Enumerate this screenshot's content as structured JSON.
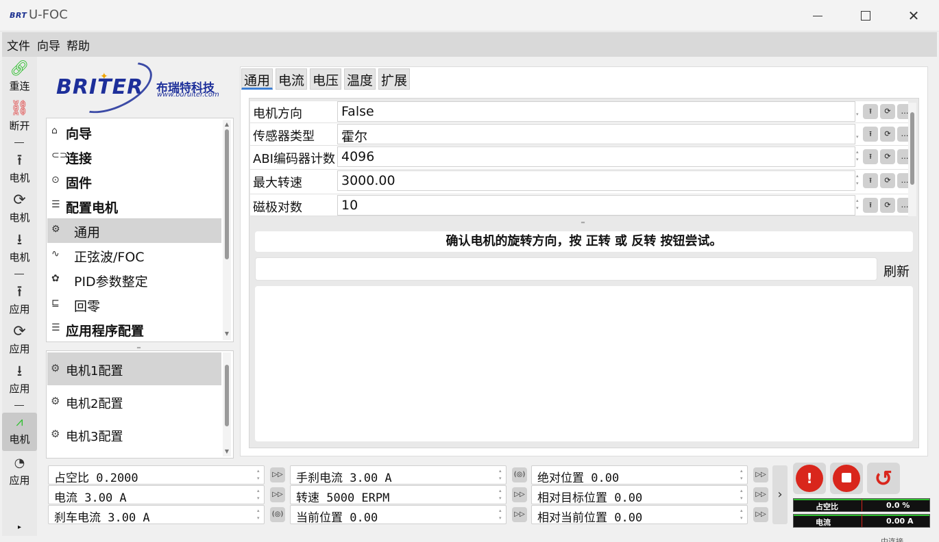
{
  "window": {
    "logo_text": "BRT",
    "title": "U-FOC"
  },
  "menu": {
    "items": [
      "文件",
      "向导",
      "帮助"
    ]
  },
  "toolbar": {
    "items": [
      {
        "icon": "link-icon",
        "label": "重连"
      },
      {
        "icon": "broken-link-icon",
        "label": "断开"
      },
      {
        "icon": "upload-icon",
        "label": "电机"
      },
      {
        "icon": "refresh-icon",
        "label": "电机"
      },
      {
        "icon": "download-icon",
        "label": "电机"
      },
      {
        "icon": "upload-icon",
        "label": "应用"
      },
      {
        "icon": "refresh-icon",
        "label": "应用"
      },
      {
        "icon": "download-icon",
        "label": "应用"
      },
      {
        "icon": "motor-chart-icon",
        "label": "电机"
      },
      {
        "icon": "app-gauge-icon",
        "label": "应用"
      }
    ],
    "accent_green": "#2fbf2f",
    "accent_red": "#e03a3a"
  },
  "brand": {
    "name": "BRITER",
    "cn": "布瑞特科技",
    "url": "www.buruiter.com"
  },
  "nav": {
    "items": [
      {
        "label": "向导",
        "level": 0
      },
      {
        "label": "连接",
        "level": 0
      },
      {
        "label": "固件",
        "level": 0
      },
      {
        "label": "配置电机",
        "level": 0
      },
      {
        "label": "通用",
        "level": 1,
        "selected": true
      },
      {
        "label": "正弦波/FOC",
        "level": 1
      },
      {
        "label": "PID参数整定",
        "level": 1
      },
      {
        "label": "回零",
        "level": 1
      },
      {
        "label": "应用程序配置",
        "level": 0
      }
    ]
  },
  "configs": {
    "items": [
      "电机1配置",
      "电机2配置",
      "电机3配置"
    ]
  },
  "tabs": {
    "items": [
      "通用",
      "电流",
      "电压",
      "温度",
      "扩展"
    ],
    "active": 0
  },
  "properties": {
    "rows": [
      {
        "name": "电机方向",
        "value": "False",
        "kind": "combo"
      },
      {
        "name": "传感器类型",
        "value": "霍尔",
        "kind": "combo"
      },
      {
        "name": "ABI编码器计数",
        "value": "4096",
        "kind": "spin"
      },
      {
        "name": "最大转速",
        "value": "3000.00",
        "kind": "spin"
      },
      {
        "name": "磁极对数",
        "value": "10",
        "kind": "spin"
      }
    ]
  },
  "hint": {
    "text": "确认电机的旋转方向，按 正转 或 反转 按钮尝试。"
  },
  "refresh": {
    "label": "刷新"
  },
  "status": {
    "col1": [
      "占空比 0.2000",
      "电流 3.00 A",
      "刹车电流 3.00 A"
    ],
    "col2": [
      "手刹电流 3.00 A",
      "转速 5000 ERPM",
      "当前位置 0.00"
    ],
    "col3": [
      "绝对位置 0.00",
      "相对目标位置 0.00",
      "相对当前位置 0.00"
    ]
  },
  "actions": {
    "alarm": "!",
    "stop": "stop",
    "redo": "↺"
  },
  "gauges": [
    {
      "label": "占空比",
      "value": "0.0 %",
      "fraction": 0.0
    },
    {
      "label": "电流",
      "value": "0.00 A",
      "fraction": 0.0
    }
  ],
  "footer": {
    "text": "中连接"
  }
}
